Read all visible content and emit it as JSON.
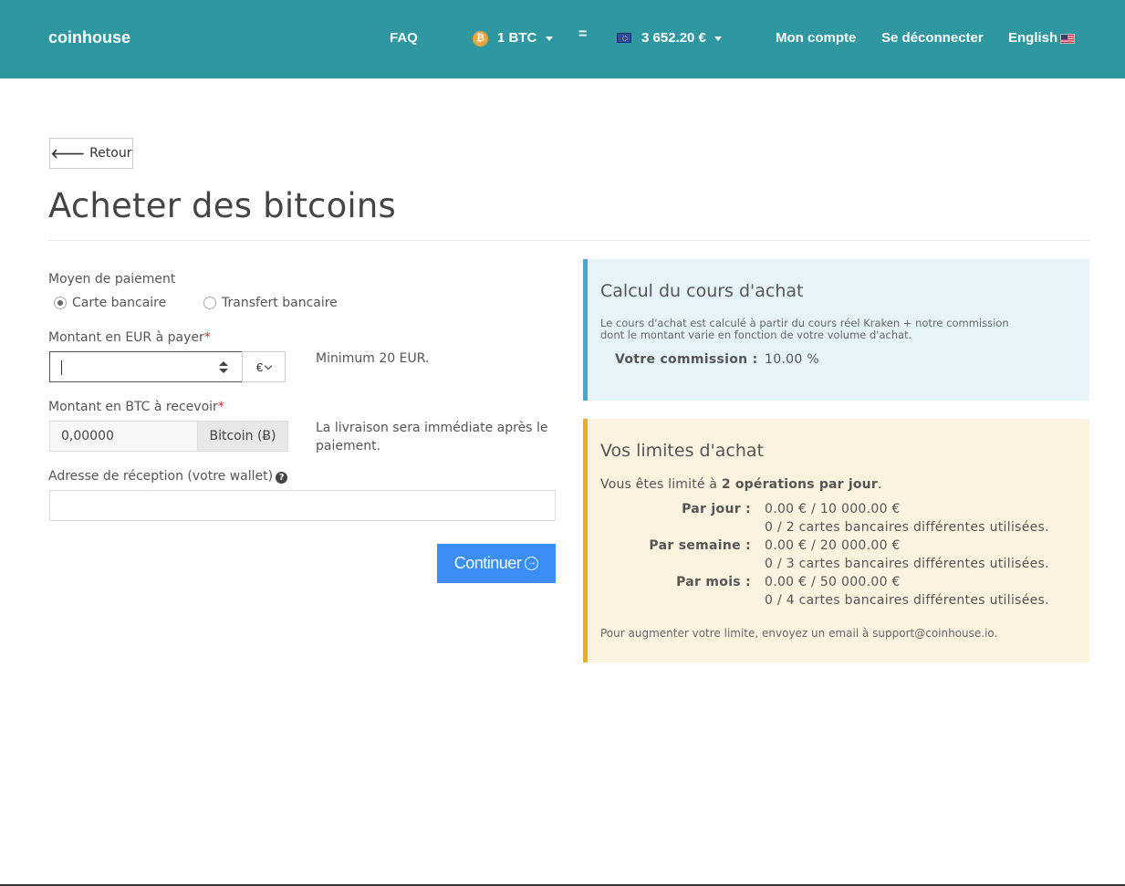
{
  "navbar": {
    "brand": "coinhouse",
    "faq": "FAQ",
    "btc_symbol": "₿",
    "btc_amount": "1 BTC",
    "equals": "=",
    "eur_amount": "3 652.20 €",
    "account": "Mon compte",
    "logout": "Se déconnecter",
    "language": "English"
  },
  "back_button": {
    "arrow": "🡐",
    "label": "Retour"
  },
  "page_title": "Acheter des bitcoins",
  "form": {
    "payment_method_label": "Moyen de paiement",
    "payment_options": [
      {
        "label": "Carte bancaire",
        "checked": true
      },
      {
        "label": "Transfert bancaire",
        "checked": false
      }
    ],
    "eur_amount_label": "Montant en EUR à payer",
    "required_mark": "*",
    "eur_amount_value": "",
    "currency_selected": "€",
    "eur_help": "Minimum 20 EUR.",
    "btc_amount_label": "Montant en BTC à recevoir",
    "btc_amount_value": "0,00000",
    "btc_addon": "Bitcoin (Ƀ)",
    "btc_help_line1": "La livraison sera immédiate après le",
    "btc_help_line2": "paiement.",
    "wallet_label": "Adresse de réception (votre wallet)",
    "info_icon": "?",
    "wallet_value": "",
    "continue_label": "Continuer",
    "continue_icon": "→"
  },
  "rate_panel": {
    "title": "Calcul du cours d'achat",
    "description_line1": "Le cours d'achat est calculé à partir du cours réel Kraken + notre commission",
    "description_line2": "dont le montant varie en fonction de votre volume d'achat.",
    "commission_label": "Votre commission :",
    "commission_value": "10.00 %"
  },
  "limits_panel": {
    "title": "Vos limites d'achat",
    "intro_prefix": "Vous êtes limité à ",
    "intro_bold": "2 opérations par jour",
    "intro_suffix": ".",
    "rows": [
      {
        "label": "Par jour :",
        "amount": "0.00 € / 10 000.00 €",
        "cards": "0 / 2 cartes bancaires différentes utilisées."
      },
      {
        "label": "Par semaine :",
        "amount": "0.00 € / 20 000.00 €",
        "cards": "0 / 3 cartes bancaires différentes utilisées."
      },
      {
        "label": "Par mois :",
        "amount": "0.00 € / 50 000.00 €",
        "cards": "0 / 4 cartes bancaires différentes utilisées."
      }
    ],
    "footer": "Pour augmenter votre limite, envoyez un email à support@coinhouse.io."
  },
  "colors": {
    "navbar": "#2e97a0",
    "primary_button": "#3a8ef6",
    "info_panel_bg": "#e6f4fa",
    "info_panel_border": "#3ea8d7",
    "warning_panel_bg": "#fbf2e0",
    "warning_panel_border": "#efac1e"
  }
}
